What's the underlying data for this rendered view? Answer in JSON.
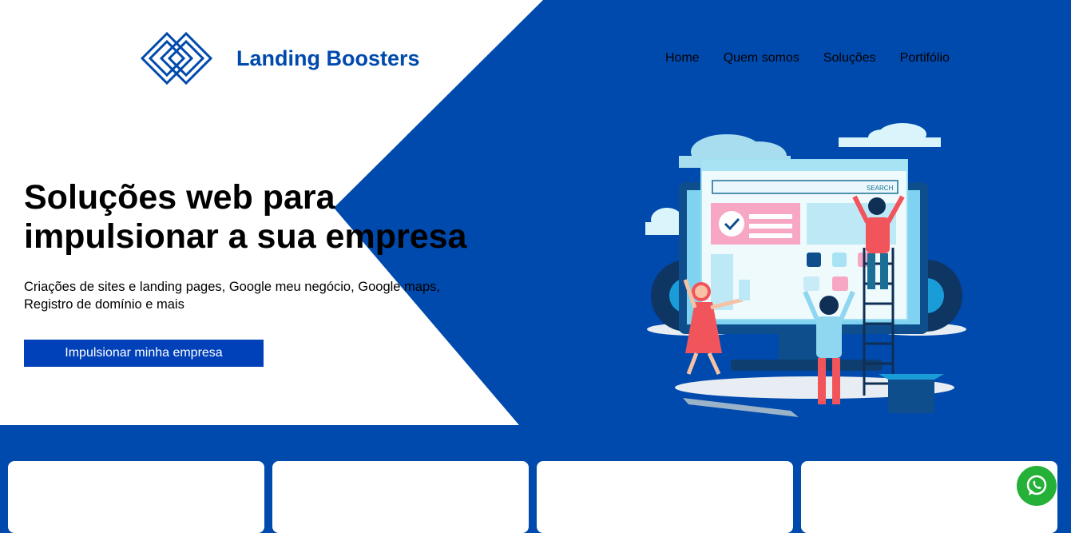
{
  "brand": {
    "name": "Landing Boosters"
  },
  "nav": {
    "items": [
      "Home",
      "Quem somos",
      "Soluções",
      "Portifólio"
    ]
  },
  "hero": {
    "headline_line1": "Soluções web para",
    "headline_line2": "impulsionar a sua empresa",
    "subtitle_line1": "Criações de sites e landing pages, Google meu negócio, Google maps,",
    "subtitle_line2": "Registro de domínio e mais",
    "cta_label": "Impulsionar minha empresa"
  },
  "illustration": {
    "search_label": "SEARCH"
  },
  "colors": {
    "brand_blue": "#004AAD",
    "whatsapp_green": "#25B038"
  },
  "floating": {
    "icon": "whatsapp-icon"
  }
}
